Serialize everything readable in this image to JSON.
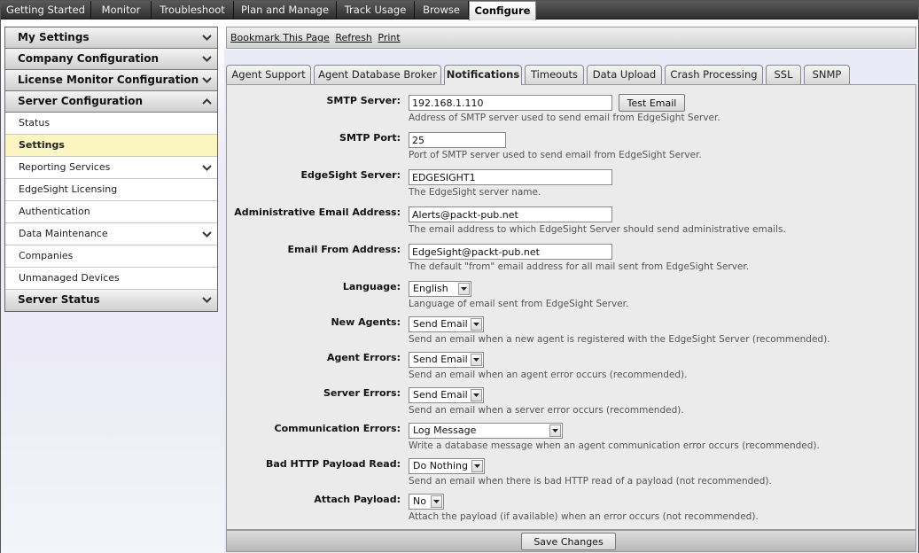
{
  "topnav": {
    "items": [
      {
        "label": "Getting Started"
      },
      {
        "label": "Monitor"
      },
      {
        "label": "Troubleshoot"
      },
      {
        "label": "Plan and Manage"
      },
      {
        "label": "Track Usage"
      },
      {
        "label": "Browse"
      },
      {
        "label": "Configure"
      }
    ],
    "active": "Configure"
  },
  "sidebar": {
    "sections": [
      {
        "label": "My Settings",
        "expanded": false
      },
      {
        "label": "Company Configuration",
        "expanded": false
      },
      {
        "label": "License Monitor Configuration",
        "expanded": false
      },
      {
        "label": "Server Configuration",
        "expanded": true
      },
      {
        "label": "Server Status",
        "expanded": false
      }
    ],
    "server_items": [
      {
        "label": "Status"
      },
      {
        "label": "Settings",
        "selected": true
      },
      {
        "label": "Reporting Services",
        "has_submenu": true
      },
      {
        "label": "EdgeSight Licensing"
      },
      {
        "label": "Authentication"
      },
      {
        "label": "Data Maintenance",
        "has_submenu": true
      },
      {
        "label": "Companies"
      },
      {
        "label": "Unmanaged Devices"
      }
    ]
  },
  "actionbar": {
    "bookmark": "Bookmark This Page",
    "refresh": "Refresh",
    "print": "Print"
  },
  "tabs": {
    "items": [
      {
        "label": "Agent Support"
      },
      {
        "label": "Agent Database Broker"
      },
      {
        "label": "Notifications"
      },
      {
        "label": "Timeouts"
      },
      {
        "label": "Data Upload"
      },
      {
        "label": "Crash Processing"
      },
      {
        "label": "SSL"
      },
      {
        "label": "SNMP"
      }
    ],
    "active": "Notifications"
  },
  "form": {
    "smtp_server": {
      "label": "SMTP Server:",
      "value": "192.168.1.110",
      "button": "Test Email",
      "description": "Address of SMTP server used to send email from EdgeSight Server."
    },
    "smtp_port": {
      "label": "SMTP Port:",
      "value": "25",
      "description": "Port of SMTP server used to send email from EdgeSight Server."
    },
    "edgesight_server": {
      "label": "EdgeSight Server:",
      "value": "EDGESIGHT1",
      "description": "The EdgeSight server name."
    },
    "admin_email": {
      "label": "Administrative Email Address:",
      "value": "Alerts@packt-pub.net",
      "description": "The email address to which EdgeSight Server should send administrative emails."
    },
    "from_address": {
      "label": "Email From Address:",
      "value": "EdgeSight@packt-pub.net",
      "description": "The default \"from\" email address for all mail sent from EdgeSight Server."
    },
    "language": {
      "label": "Language:",
      "value": "English",
      "description": "Language of email sent from EdgeSight Server."
    },
    "new_agents": {
      "label": "New Agents:",
      "value": "Send Email",
      "description": "Send an email when a new agent is registered with the EdgeSight Server (recommended)."
    },
    "agent_errors": {
      "label": "Agent Errors:",
      "value": "Send Email",
      "description": "Send an email when an agent error occurs (recommended)."
    },
    "server_errors": {
      "label": "Server Errors:",
      "value": "Send Email",
      "description": "Send an email when a server error occurs (recommended)."
    },
    "communication_errors": {
      "label": "Communication Errors:",
      "value": "Log Message",
      "description": "Write a database message when an agent communication error occurs (recommended)."
    },
    "bad_http_payload": {
      "label": "Bad HTTP Payload Read:",
      "value": "Do Nothing",
      "description": "Send an email when there is bad HTTP read of a payload (not recommended)."
    },
    "attach_payload": {
      "label": "Attach Payload:",
      "value": "No",
      "description": "Attach the payload (if available) when an error occurs (not recommended)."
    }
  },
  "footer": {
    "save_label": "Save Changes"
  },
  "colors": {
    "selected_item_bg": "#fbf5c1",
    "panel_bg": "#ebebeb",
    "page_bg": "#eaeaf6",
    "topnav_bg": "#3c3c3c"
  },
  "icons": {
    "collapsed": "chevron-down-icon",
    "expanded": "chevron-up-icon",
    "dropdown": "dropdown-arrow-icon"
  }
}
